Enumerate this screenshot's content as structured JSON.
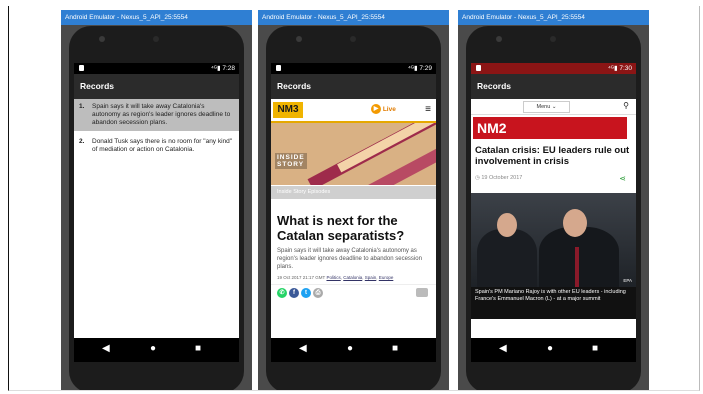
{
  "window_title": "Android Emulator - Nexus_5_API_25:5554",
  "app_title": "Records",
  "panels": [
    {
      "time": "7:28"
    },
    {
      "time": "7:29"
    },
    {
      "time": "7:30"
    }
  ],
  "records": [
    {
      "num": "1.",
      "text": "Spain says it will take away Catalonia's autonomy as region's leader ignores deadline to abandon secession plans."
    },
    {
      "num": "2.",
      "text": "Donald Tusk says there is no room for \"any kind\" of mediation or action on Catalonia."
    }
  ],
  "nm3": {
    "logo": "NM3",
    "live_label": "Live",
    "inside_label_1": "INSIDE",
    "inside_label_2": "STORY",
    "episodes_label": "Inside Story Episodes",
    "headline": "What is next for the Catalan separatists?",
    "summary": "Spain says it will take away Catalonia's autonomy as region's leader ignores deadline to abandon secession plans.",
    "meta_date": "19 Oct 2017 21:17 GMT",
    "tags": [
      "Politics",
      "Catalonia",
      "Spain",
      "Europe"
    ]
  },
  "nm2": {
    "menu_label": "Menu ⌄",
    "logo": "NM2",
    "headline": "Catalan crisis: EU leaders rule out involvement in crisis",
    "date": "19 October 2017",
    "photo_credit": "EPA",
    "caption": "Spain's PM Mariano Rajoy is with other EU leaders - including France's Emmanuel Macron (L) - at a major summit"
  },
  "icons": {
    "back": "◀",
    "home": "●",
    "recent": "■",
    "menu": "≡",
    "search": "⚲",
    "clock": "◷",
    "share": "⋖",
    "play": "▶"
  },
  "colors": {
    "titlebar": "#2f7fd3",
    "nm3_accent": "#f0b400",
    "nm2_red": "#c8141e",
    "share_green": "#2e9e3a"
  }
}
